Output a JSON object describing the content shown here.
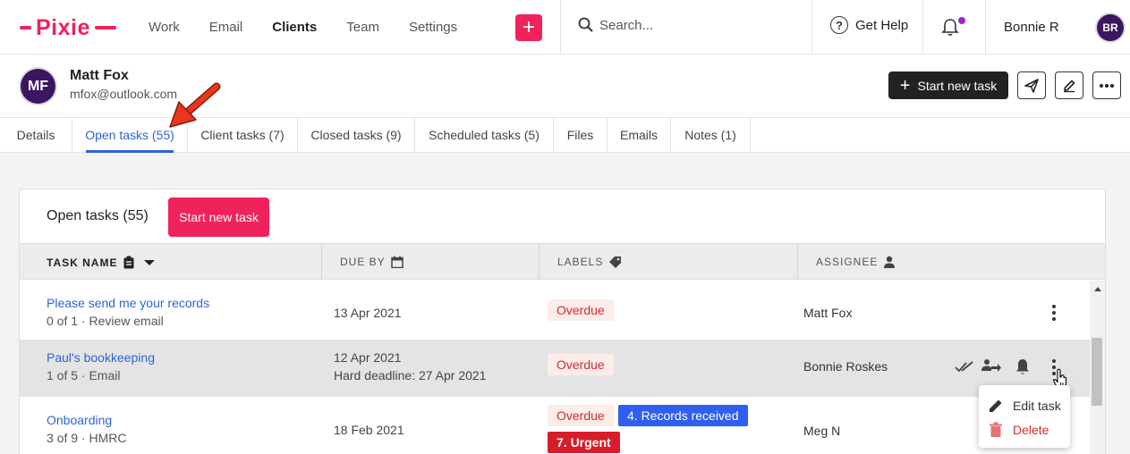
{
  "app": {
    "logo_text": "Pixie",
    "brand_color": "#f0225b"
  },
  "nav": {
    "items": [
      "Work",
      "Email",
      "Clients",
      "Team",
      "Settings"
    ],
    "active": "Clients"
  },
  "search": {
    "placeholder": "Search..."
  },
  "help": {
    "label": "Get Help"
  },
  "user": {
    "name": "Bonnie R",
    "initials": "BR"
  },
  "client": {
    "name": "Matt Fox",
    "email": "mfox@outlook.com",
    "initials": "MF",
    "start_task_label": "Start new task"
  },
  "tabs": [
    {
      "label": "Details"
    },
    {
      "label": "Open tasks (55)"
    },
    {
      "label": "Client tasks (7)"
    },
    {
      "label": "Closed tasks (9)"
    },
    {
      "label": "Scheduled tasks (5)"
    },
    {
      "label": "Files"
    },
    {
      "label": "Emails"
    },
    {
      "label": "Notes (1)"
    }
  ],
  "active_tab": "Open tasks (55)",
  "panel": {
    "title": "Open tasks (55)",
    "start_task_label": "Start new task",
    "columns": {
      "task_name": "TASK NAME",
      "due_by": "DUE BY",
      "labels": "LABELS",
      "assignee": "ASSIGNEE"
    }
  },
  "tasks": [
    {
      "name": "Please send me your records",
      "sub": "0 of 1 · Review email",
      "due": "13 Apr 2021",
      "labels": [
        "Overdue"
      ],
      "assignee": "Matt Fox"
    },
    {
      "name": "Paul's bookkeeping",
      "sub": "1 of 5 · Email",
      "due": "12 Apr 2021",
      "deadline": "Hard deadline:  27 Apr 2021",
      "labels": [
        "Overdue"
      ],
      "assignee": "Bonnie Roskes"
    },
    {
      "name": "Onboarding",
      "sub": "3 of 9 · HMRC",
      "due": "18 Feb 2021",
      "labels": [
        "Overdue",
        "4. Records received",
        "7. Urgent"
      ],
      "assignee": "Meg N"
    }
  ],
  "context_menu": {
    "edit": "Edit task",
    "delete": "Delete"
  },
  "colors": {
    "link_blue": "#2f63d8",
    "overdue_bg": "#fdecea",
    "overdue_text": "#d22d2d",
    "label_blue": "#2f5fef",
    "label_red": "#d81d2a",
    "avatar_bg": "#3c1660",
    "notify_dot": "#9b26d3"
  }
}
